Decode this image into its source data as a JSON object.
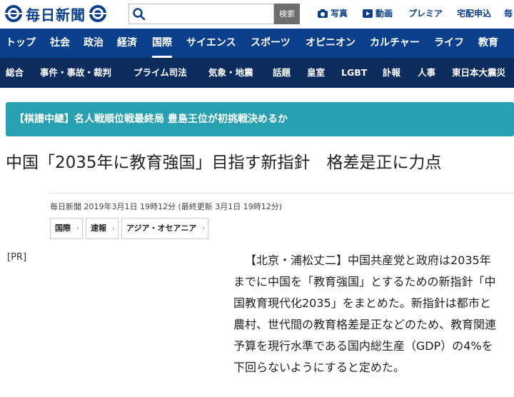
{
  "header": {
    "logo_text": "毎日新聞",
    "search_placeholder": "",
    "search_button": "検索",
    "links": [
      {
        "label": "写真",
        "icon": "camera-icon"
      },
      {
        "label": "動画",
        "icon": "play-icon"
      },
      {
        "label": "プレミア",
        "icon": ""
      },
      {
        "label": "宅配申込",
        "icon": ""
      },
      {
        "label": "毎",
        "icon": ""
      }
    ]
  },
  "main_nav": [
    "トップ",
    "社会",
    "政治",
    "経済",
    "国際",
    "サイエンス",
    "スポーツ",
    "オピニオン",
    "カルチャー",
    "ライフ",
    "教育"
  ],
  "sub_nav": [
    "総合",
    "事件・事故・裁判",
    "プライム司法",
    "気象・地震",
    "話題",
    "皇室",
    "LGBT",
    "訃報",
    "人事",
    "東日本大震災"
  ],
  "banner": {
    "text": "【棋譜中継】名人戦順位戦最終局 豊島王位が初挑戦決めるか"
  },
  "article": {
    "headline": "中国「2035年に教育強国」目指す新指針　格差是正に力点",
    "meta": "毎日新聞 2019年3月1日 19時12分 (最終更新 3月1日 19時12分)",
    "tags": [
      "国際",
      "速報",
      "アジア・オセアニア"
    ],
    "pr": "[PR]",
    "body": "【北京・浦松丈二】中国共産党と政府は2035年までに中国を「教育強国」とするための新指針「中国教育現代化2035」をまとめた。新指針は都市と農村、世代間の教育格差是正などのため、教育関連予算を現行水準である国内総生産（GDP）の4%を下回らないようにすると定めた。"
  },
  "colors": {
    "nav_blue": "#0a3f8c",
    "subnav_navy": "#0b2c5c",
    "banner_teal": "#27a0b1"
  }
}
